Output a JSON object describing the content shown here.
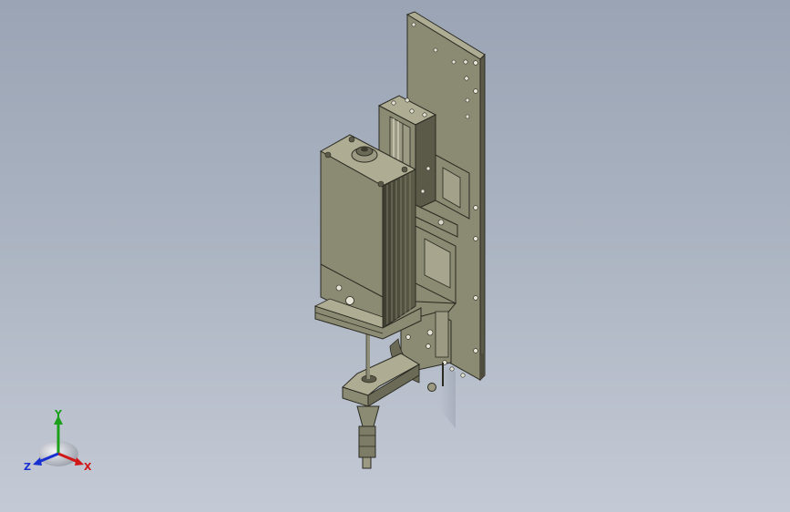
{
  "app": {
    "view": "isometric-3d-model"
  },
  "triad": {
    "x_label": "X",
    "y_label": "Y",
    "z_label": "Z",
    "colors": {
      "x": "#d01818",
      "y": "#1aa01a",
      "z": "#1830d0"
    }
  },
  "model": {
    "icons": [
      "backplate",
      "servo-motor",
      "linear-guide",
      "spindle-arm",
      "nozzle"
    ],
    "colors": {
      "body": "#8b8a72",
      "dark": "#5b5a48",
      "light": "#aeac92",
      "edge": "#2a2a22"
    }
  }
}
